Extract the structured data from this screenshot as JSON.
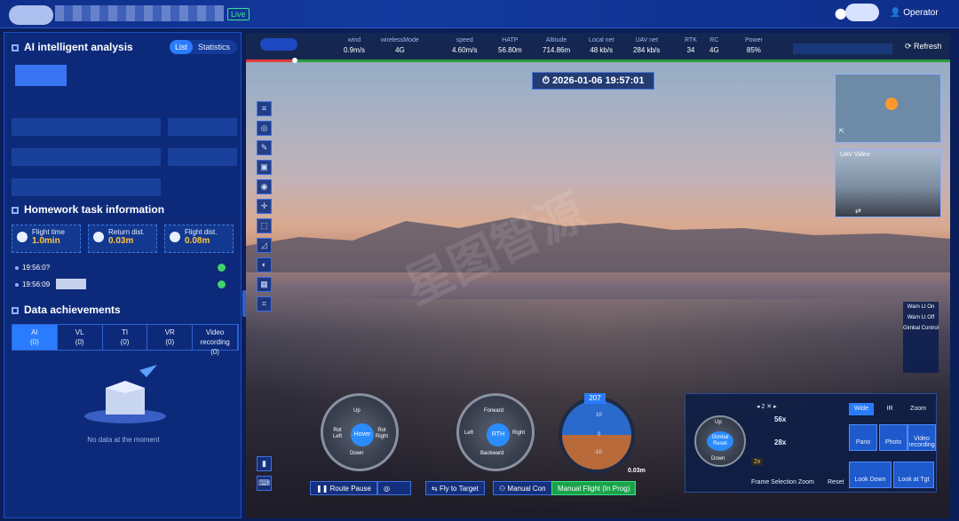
{
  "header": {
    "live_badge": "Live",
    "operator": "Operator"
  },
  "left_panel": {
    "ai_title": "AI intelligent analysis",
    "view_toggle": [
      "List",
      "Statistics"
    ],
    "homework_title": "Homework task information",
    "stats": [
      {
        "label": "Flight time",
        "value": "1.0min"
      },
      {
        "label": "Return dist.",
        "value": "0.03m"
      },
      {
        "label": "Flight dist.",
        "value": "0.08m"
      }
    ],
    "log": [
      "19:56:0?",
      "19:56:09"
    ],
    "achievements_title": "Data achievements",
    "tabs": [
      {
        "label": "AI",
        "count": "(0)"
      },
      {
        "label": "VL",
        "count": "(0)"
      },
      {
        "label": "TI",
        "count": "(0)"
      },
      {
        "label": "VR",
        "count": "(0)"
      },
      {
        "label": "Video recording",
        "count": "(0)"
      }
    ],
    "empty_text": "No data at the moment"
  },
  "status_bar": {
    "items": [
      {
        "label": "wind",
        "value": "0.9m/s"
      },
      {
        "label": "wirelessMode",
        "value": "4G"
      },
      {
        "label": "speed",
        "value": "4.60m/s"
      },
      {
        "label": "HATP",
        "value": "56.80m"
      },
      {
        "label": "Altitude",
        "value": "714.86m"
      },
      {
        "label": "Local net",
        "value": "48 kb/s"
      },
      {
        "label": "UAV net",
        "value": "284 kb/s"
      },
      {
        "label": "RTK",
        "value": "34"
      },
      {
        "label": "RC",
        "value": "4G"
      },
      {
        "label": "Power",
        "value": "85%"
      }
    ],
    "refresh": "Refresh",
    "progress": 0.065
  },
  "timestamp": "2026-01-06 19:57:01",
  "pip": {
    "label": "UAV Video"
  },
  "side_controls": [
    "Warn Lt On",
    "Warn Lt Off",
    "Gimbal Control"
  ],
  "pads": {
    "left": {
      "center": "Hover",
      "up": "Up",
      "down": "Down",
      "left": "Rot Left",
      "right": "Rot Right"
    },
    "right": {
      "center": "RTH",
      "up": "Forward",
      "down": "Backward",
      "left": "Left",
      "right": "Right"
    },
    "gimbal": {
      "center": "Gimbal Reset",
      "up": "Up",
      "down": "Down"
    }
  },
  "attitude": {
    "heading": "207",
    "alt_diff": "0.03m",
    "marks": [
      "10",
      "0",
      "-10"
    ]
  },
  "camera": {
    "tabs": [
      "Wide",
      "IR",
      "Zoom"
    ],
    "zoom_values": [
      "56x",
      "28x",
      "2x"
    ],
    "zoom_step": "2",
    "buttons": [
      "Pano",
      "Photo",
      "Video recording",
      "Look Down",
      "Look at Tgt"
    ],
    "frame_zoom": "Frame Selection Zoom",
    "reset": "Reset"
  },
  "bottom_buttons": [
    "Route Pause",
    "Fly to Target",
    "Manual Con",
    "Manual Flight (In Prog)"
  ],
  "watermark": "星图智源"
}
